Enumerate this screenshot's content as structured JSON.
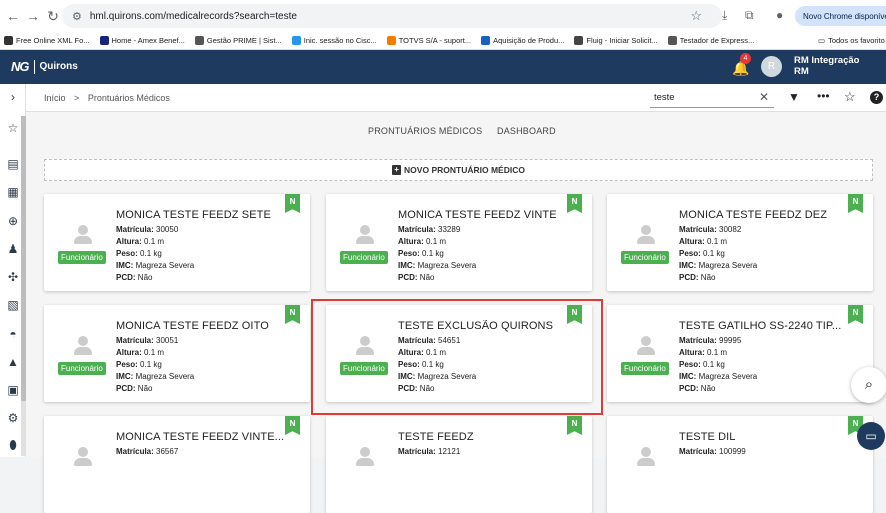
{
  "browser": {
    "url": "hml.quirons.com/medicalrecords?search=teste",
    "new_chrome": "Novo Chrome disponível",
    "bookmarks": [
      {
        "label": "Free Online XML Fo...",
        "color": "#333333"
      },
      {
        "label": "Home - Amex Benef...",
        "color": "#1a237e"
      },
      {
        "label": "Gestão PRIME | Sist...",
        "color": "#555555"
      },
      {
        "label": "Inic. sessão no Cisc...",
        "color": "#2196f3"
      },
      {
        "label": "TOTVS S/A - suport...",
        "color": "#f57c00"
      },
      {
        "label": "Aquisição de Produ...",
        "color": "#1565c0"
      },
      {
        "label": "Fluig - Iniciar Solicit...",
        "color": "#444444"
      },
      {
        "label": "Testador de Express...",
        "color": "#555555"
      }
    ],
    "all_favorites": "Todos os favorito"
  },
  "app": {
    "logo_mark": "NG",
    "logo_name": "Quirons",
    "notification_count": "4",
    "avatar_initial": "R",
    "user_name_line1": "RM Integração",
    "user_name_line2": "RM"
  },
  "topbar": {
    "breadcrumb_home": "Início",
    "breadcrumb_sep": ">",
    "breadcrumb_current": "Prontuários Médicos",
    "search_value": "teste"
  },
  "tabs": {
    "records": "PRONTUÁRIOS MÉDICOS",
    "dashboard": "DASHBOARD"
  },
  "new_button": "NOVO PRONTUÁRIO MÉDICO",
  "labels": {
    "matricula": "Matrícula:",
    "altura": "Altura:",
    "peso": "Peso:",
    "imc": "IMC:",
    "pcd": "PCD:"
  },
  "cards": [
    {
      "name": "MONICA TESTE FEEDZ SETE",
      "matricula": "30050",
      "altura": "0.1 m",
      "peso": "0.1 kg",
      "imc": "Magreza Severa",
      "pcd": "Não",
      "role": "Funcionário",
      "flag": "N"
    },
    {
      "name": "MONICA TESTE FEEDZ VINTE",
      "matricula": "33289",
      "altura": "0.1 m",
      "peso": "0.1 kg",
      "imc": "Magreza Severa",
      "pcd": "Não",
      "role": "Funcionário",
      "flag": "N"
    },
    {
      "name": "MONICA TESTE FEEDZ DEZ",
      "matricula": "30082",
      "altura": "0.1 m",
      "peso": "0.1 kg",
      "imc": "Magreza Severa",
      "pcd": "Não",
      "role": "Funcionário",
      "flag": "N"
    },
    {
      "name": "MONICA TESTE FEEDZ OITO",
      "matricula": "30051",
      "altura": "0.1 m",
      "peso": "0.1 kg",
      "imc": "Magreza Severa",
      "pcd": "Não",
      "role": "Funcionário",
      "flag": "N"
    },
    {
      "name": "TESTE EXCLUSÃO QUIRONS",
      "matricula": "54651",
      "altura": "0.1 m",
      "peso": "0.1 kg",
      "imc": "Magreza Severa",
      "pcd": "Não",
      "role": "Funcionário",
      "flag": "N"
    },
    {
      "name": "TESTE GATILHO SS-2240 TIP...",
      "matricula": "99995",
      "altura": "0.1 m",
      "peso": "0.1 kg",
      "imc": "Magreza Severa",
      "pcd": "Não",
      "role": "Funcionário",
      "flag": "N"
    },
    {
      "name": "MONICA TESTE FEEDZ VINTE...",
      "matricula": "36567",
      "altura": "",
      "peso": "",
      "imc": "",
      "pcd": "",
      "role": "",
      "flag": "N"
    },
    {
      "name": "TESTE FEEDZ",
      "matricula": "12121",
      "altura": "",
      "peso": "",
      "imc": "",
      "pcd": "",
      "role": "",
      "flag": "N"
    },
    {
      "name": "TESTE DIL",
      "matricula": "100999",
      "altura": "",
      "peso": "",
      "imc": "",
      "pcd": "",
      "role": "",
      "flag": "N"
    }
  ]
}
